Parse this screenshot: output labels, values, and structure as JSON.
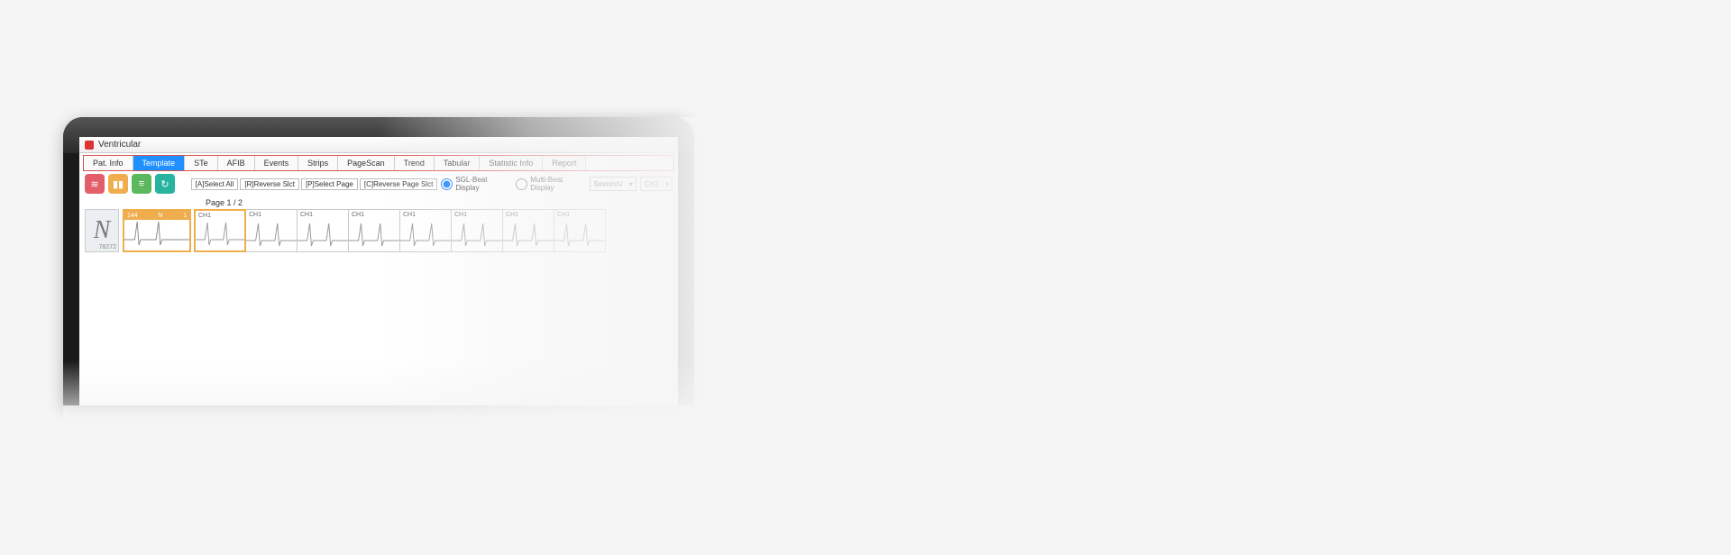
{
  "window": {
    "title": "Ventricular"
  },
  "tabs": [
    {
      "label": "Pat. Info",
      "active": false
    },
    {
      "label": "Template",
      "active": true
    },
    {
      "label": "STe",
      "active": false
    },
    {
      "label": "AFIB",
      "active": false
    },
    {
      "label": "Events",
      "active": false
    },
    {
      "label": "Strips",
      "active": false
    },
    {
      "label": "PageScan",
      "active": false
    },
    {
      "label": "Trend",
      "active": false
    },
    {
      "label": "Tabular",
      "active": false
    },
    {
      "label": "Statistic Info",
      "active": false
    },
    {
      "label": "Report",
      "active": false
    }
  ],
  "toolbar": {
    "buttons": [
      {
        "name": "graph-icon",
        "color": "red",
        "glyph": "≋"
      },
      {
        "name": "bars-icon",
        "color": "orange",
        "glyph": "▮▮"
      },
      {
        "name": "list-icon",
        "color": "green",
        "glyph": "≡"
      },
      {
        "name": "refresh-icon",
        "color": "teal",
        "glyph": "↻"
      }
    ],
    "actions": [
      {
        "label": "[A]Select All",
        "name": "select-all-action"
      },
      {
        "label": "[R]Reverse Slct",
        "name": "reverse-select-action"
      },
      {
        "label": "[P]Select Page",
        "name": "select-page-action"
      },
      {
        "label": "[C]Reverse Page Slct",
        "name": "reverse-page-select-action"
      }
    ],
    "display_mode": {
      "options": [
        {
          "label": "SGL-Beat Display",
          "checked": true
        },
        {
          "label": "Multi-Beat Display",
          "checked": false
        }
      ]
    },
    "gain_select": {
      "value": "5mm/mV"
    },
    "channel_select": {
      "value": "CH1"
    }
  },
  "page": {
    "label": "Page 1 / 2"
  },
  "category_tile": {
    "letter": "N",
    "count": "78272"
  },
  "preview_card": {
    "top_left": "144",
    "top_mid": "N",
    "top_right": "1"
  },
  "strip_cells": [
    {
      "label": "CH1",
      "selected": true
    },
    {
      "label": "CH1"
    },
    {
      "label": "CH1"
    },
    {
      "label": "CH1"
    },
    {
      "label": "CH1"
    },
    {
      "label": "CH1"
    },
    {
      "label": "CH1"
    },
    {
      "label": "CH1"
    }
  ]
}
